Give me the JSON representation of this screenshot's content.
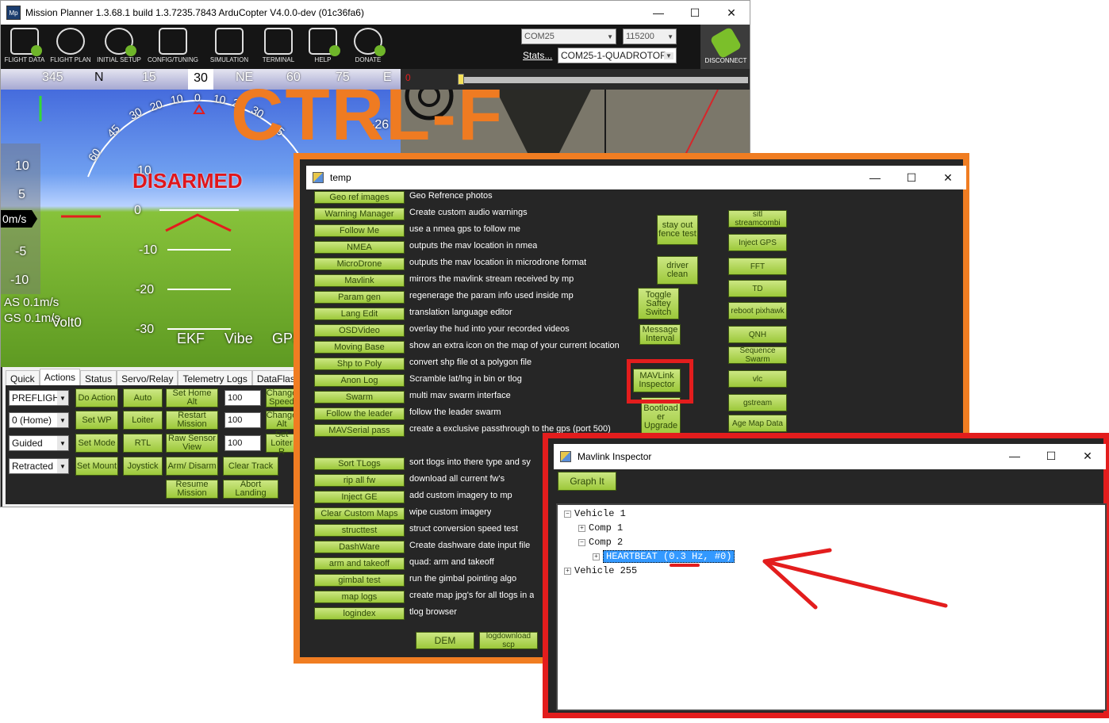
{
  "main_window": {
    "title": "Mission Planner 1.3.68.1 build 1.3.7235.7843 ArduCopter V4.0.0-dev (01c36fa6)",
    "app_icon": "Mp",
    "controls": {
      "minimize": "—",
      "maximize": "☐",
      "close": "✕"
    }
  },
  "toolbar": {
    "buttons": [
      "FLIGHT DATA",
      "FLIGHT PLAN",
      "INITIAL SETUP",
      "CONFIG/TUNING",
      "SIMULATION",
      "TERMINAL",
      "HELP",
      "DONATE"
    ],
    "com_port": "COM25",
    "baud": "115200",
    "stats_link": "Stats...",
    "vehicle_select": "COM25-1-QUADROTOR",
    "disconnect": "DISCONNECT"
  },
  "hud": {
    "compass_labels": [
      "345",
      "N",
      "15",
      "NE",
      "60",
      "75",
      "E"
    ],
    "heading": "30",
    "status": "DISARMED",
    "speed_ticks": [
      "10",
      "5",
      "-5",
      "-10"
    ],
    "speed": "0m/s",
    "pitch_labels": [
      "10",
      "0",
      "-10",
      "-20",
      "-30"
    ],
    "roll_labels": [
      "60",
      "45",
      "30",
      "20",
      "10",
      "0",
      "10",
      "20",
      "30",
      "45"
    ],
    "airspeed": "AS 0.1m/s",
    "groundspeed": "GS 0.1m/s",
    "battery": "Volt0",
    "footer_labels": [
      "EKF",
      "Vibe",
      "GPS"
    ],
    "partial_label": "-26"
  },
  "overlay_text": "CTRL-F",
  "video": {
    "value_left": "0"
  },
  "actions": {
    "tabs": [
      "Quick",
      "Actions",
      "Status",
      "Servo/Relay",
      "Telemetry Logs",
      "DataFlash"
    ],
    "dropdowns": [
      "PREFLIGH",
      "0 (Home)",
      "Guided",
      "Retracted"
    ],
    "buttons": [
      "Do Action",
      "Auto",
      "Set Home Alt",
      "Set WP",
      "Loiter",
      "Restart Mission",
      "Set Mode",
      "RTL",
      "Raw Sensor View",
      "Set Mount",
      "Joystick",
      "Arm/ Disarm",
      "Clear Track",
      "Resume Mission",
      "Abort Landing"
    ],
    "spinners": [
      "100",
      "100",
      "100"
    ],
    "side_buttons": [
      "Change Speed",
      "Change Alt",
      "Set Loiter R"
    ]
  },
  "temp_window": {
    "title": "temp",
    "rows": [
      {
        "button": "Geo ref images",
        "desc": "Geo Refrence photos"
      },
      {
        "button": "Warning Manager",
        "desc": "Create custom audio warnings"
      },
      {
        "button": "Follow Me",
        "desc": "use a nmea gps to follow me"
      },
      {
        "button": "NMEA",
        "desc": "outputs the mav location in nmea"
      },
      {
        "button": "MicroDrone",
        "desc": "outputs the mav location in microdrone format"
      },
      {
        "button": "Mavlink",
        "desc": "mirrors the mavlink stream received by mp"
      },
      {
        "button": "Param gen",
        "desc": "regenerage the param info used inside mp"
      },
      {
        "button": "Lang Edit",
        "desc": "translation language editor"
      },
      {
        "button": "OSDVideo",
        "desc": "overlay the hud into your recorded videos"
      },
      {
        "button": "Moving Base",
        "desc": "show an extra icon on the map of your current location"
      },
      {
        "button": "Shp to Poly",
        "desc": "convert shp file ot a polygon file"
      },
      {
        "button": "Anon Log",
        "desc": "Scramble lat/lng in bin or tlog"
      },
      {
        "button": "Swarm",
        "desc": "multi mav swarm interface"
      },
      {
        "button": "Follow the leader",
        "desc": "follow the leader swarm"
      },
      {
        "button": "MAVSerial pass",
        "desc": "create a exclusive passthrough to the gps (port 500)"
      },
      {
        "button": "Sort TLogs",
        "desc": "sort tlogs into there type and sy"
      },
      {
        "button": "rip all fw",
        "desc": "download all current fw's"
      },
      {
        "button": "Inject GE",
        "desc": "add custom imagery to mp"
      },
      {
        "button": "Clear Custom Maps",
        "desc": "wipe custom imagery"
      },
      {
        "button": "structtest",
        "desc": "struct conversion speed test"
      },
      {
        "button": "DashWare",
        "desc": "Create dashware date input file"
      },
      {
        "button": "arm and takeoff",
        "desc": "quad: arm and takeoff"
      },
      {
        "button": "gimbal test",
        "desc": "run the gimbal pointing algo"
      },
      {
        "button": "map logs",
        "desc": "create map jpg's for all tlogs in a"
      },
      {
        "button": "logindex",
        "desc": "tlog browser"
      }
    ],
    "col2": [
      "stay out fence test",
      "driver clean",
      "Toggle Saftey Switch",
      "Message Interval",
      "MAVLink Inspector",
      "Bootload er Upgrade"
    ],
    "col3": [
      "sitl streamcombi",
      "Inject GPS",
      "FFT",
      "TD",
      "reboot pixhawk",
      "QNH",
      "Sequence Swarm",
      "vlc",
      "gstream",
      "Age Map Data"
    ],
    "bottom": [
      "DEM",
      "logdownload scp"
    ]
  },
  "inspector_window": {
    "title": "Mavlink Inspector",
    "graph_button": "Graph It",
    "tree": {
      "vehicle1": "Vehicle 1",
      "comp1": "Comp 1",
      "comp2": "Comp 2",
      "heartbeat": "HEARTBEAT (0.3 Hz, #0)",
      "vehicle255": "Vehicle 255"
    }
  },
  "colors": {
    "accent_orange": "#f07d22",
    "highlight_red": "#e31d1d",
    "button_green": "#b5d85c",
    "tree_select": "#3399ff"
  }
}
